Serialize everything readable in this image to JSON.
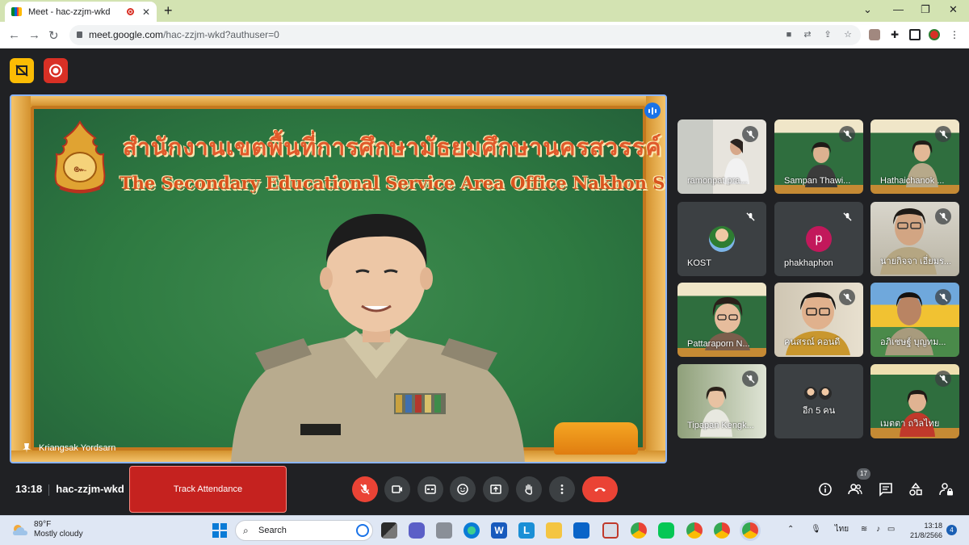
{
  "browser": {
    "tab_title": "Meet - hac-zzjm-wkd",
    "url_host": "meet.google.com",
    "url_path": "/hac-zzjm-wkd?authuser=0"
  },
  "main_video": {
    "heading_th": "สำนักงานเขตพื้นที่การศึกษามัธยมศึกษานครสวรรค์",
    "heading_en": "The Secondary Educational Service Area Office Nakhon Sawan",
    "speaker_name": "Kriangsak Yordsarn"
  },
  "participants": [
    {
      "name": "ramonpat pra...",
      "muted": true,
      "bg": "video-room"
    },
    {
      "name": "Sampan Thawi...",
      "muted": true,
      "bg": "green-board"
    },
    {
      "name": "Hathaichanok ...",
      "muted": true,
      "bg": "green-board"
    },
    {
      "name": "KOST",
      "muted": true,
      "bg": "avatar-photo"
    },
    {
      "name": "phakhaphon",
      "muted": true,
      "bg": "avatar-letter",
      "initial": "p",
      "color": "#c2185b"
    },
    {
      "name": "นายกิจจา เอี่ยมร...",
      "muted": true,
      "bg": "video-room"
    },
    {
      "name": "Pattaraporn N...",
      "muted": false,
      "bg": "green-board"
    },
    {
      "name": "คนสรณ์ คอนดี",
      "muted": true,
      "bg": "video-room"
    },
    {
      "name": "อภิเชษฐ์ บุญทม...",
      "muted": true,
      "bg": "video-room"
    },
    {
      "name": "Tipapan Kengk...",
      "muted": true,
      "bg": "video-room"
    },
    {
      "name": "อีก 5 คน",
      "muted": false,
      "bg": "more"
    },
    {
      "name": "เมตตา ถวิลไทย",
      "muted": true,
      "bg": "green-board"
    }
  ],
  "bottom_bar": {
    "time": "13:18",
    "meeting_code": "hac-zzjm-wkd",
    "track_attendance": "Track Attendance",
    "people_count": "17"
  },
  "taskbar": {
    "temp": "89°F",
    "weather": "Mostly cloudy",
    "search": "Search",
    "lang": "ไทย",
    "clock_time": "13:18",
    "clock_date": "21/8/2566",
    "notifications": "4"
  },
  "colors": {
    "meet_bg": "#202124",
    "accent_blue": "#8ab4f8",
    "end_call_red": "#ea4335",
    "mic_off_red": "#ea4335",
    "track_red": "#c5221f"
  }
}
